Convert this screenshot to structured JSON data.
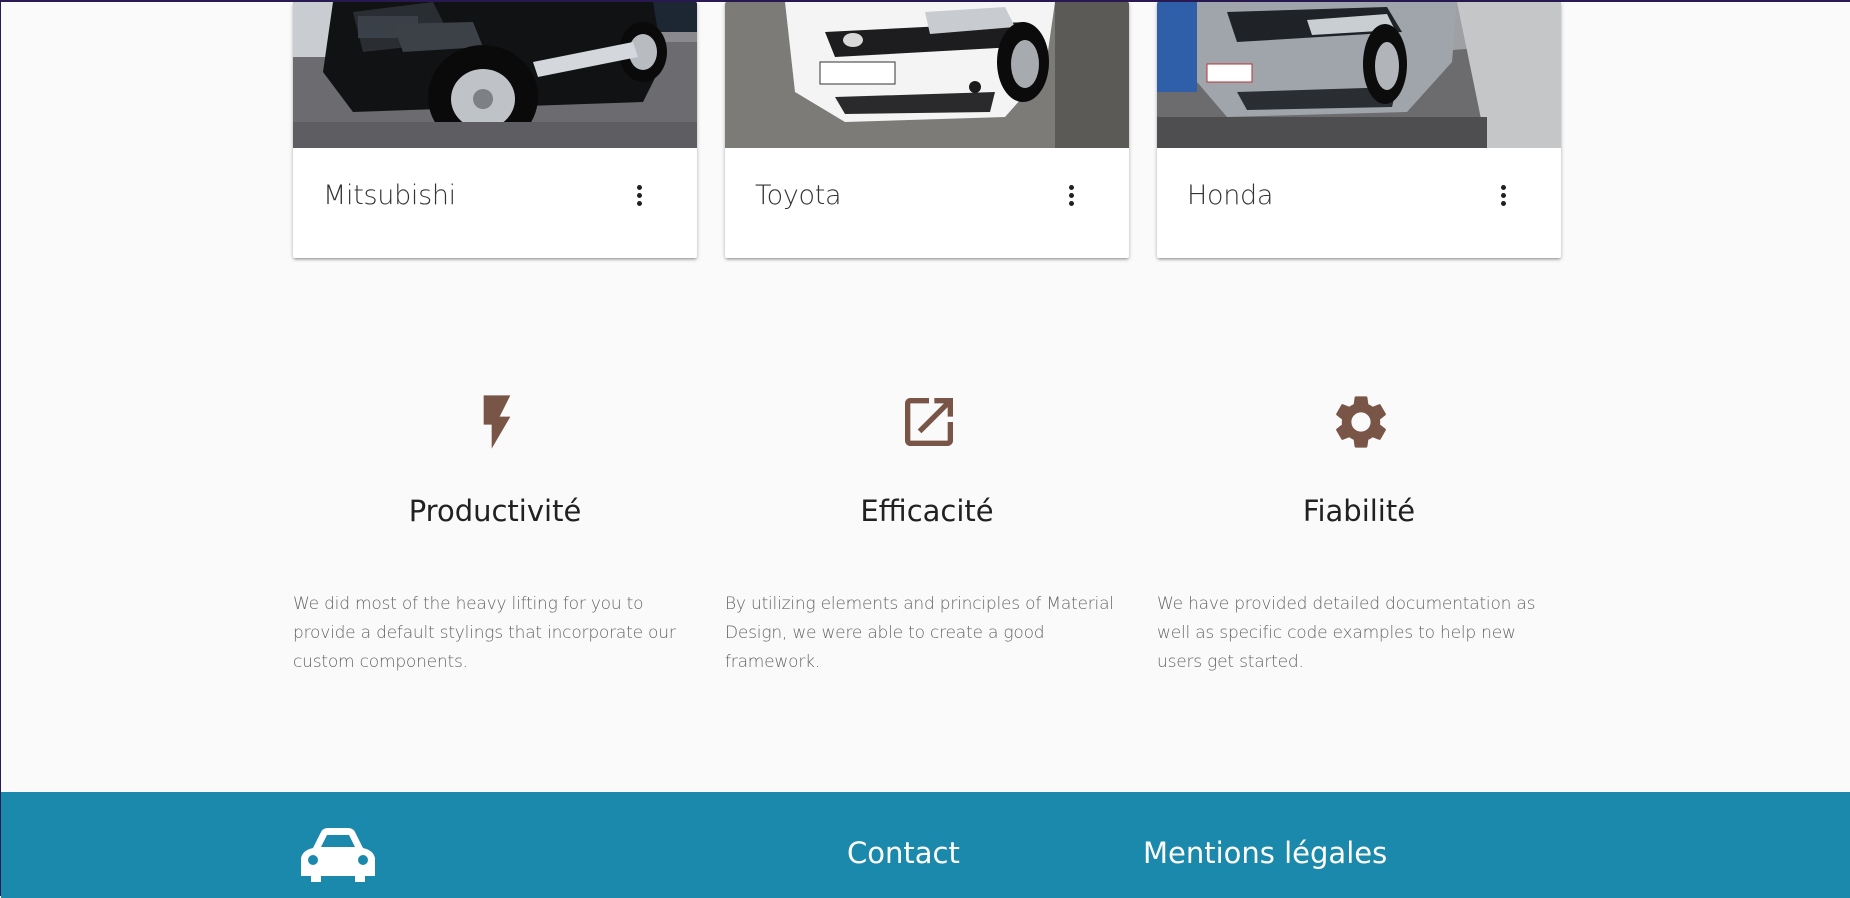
{
  "cards": [
    {
      "title": "Mitsubishi",
      "image_icon": "car-photo-mitsubishi",
      "menu_icon": "more-vert-icon"
    },
    {
      "title": "Toyota",
      "image_icon": "car-photo-toyota",
      "menu_icon": "more-vert-icon"
    },
    {
      "title": "Honda",
      "image_icon": "car-photo-honda",
      "menu_icon": "more-vert-icon"
    }
  ],
  "features": [
    {
      "icon": "flash-icon",
      "title": "Productivité",
      "text": "We did most of the heavy lifting for you to provide a default stylings that incorporate our custom components."
    },
    {
      "icon": "open-in-new-icon",
      "title": "Efficacité",
      "text": "By utilizing elements and principles of Material Design, we were able to create a good framework."
    },
    {
      "icon": "gear-icon",
      "title": "Fiabilité",
      "text": "We have provided detailed documentation as well as specific code examples to help new users get started."
    }
  ],
  "footer": {
    "logo_icon": "car-icon",
    "contact_heading": "Contact",
    "legal_heading": "Mentions légales"
  },
  "colors": {
    "background": "#fafafa",
    "footer": "#1a89ab",
    "feature_icon": "#795548",
    "card_title": "#333333"
  }
}
